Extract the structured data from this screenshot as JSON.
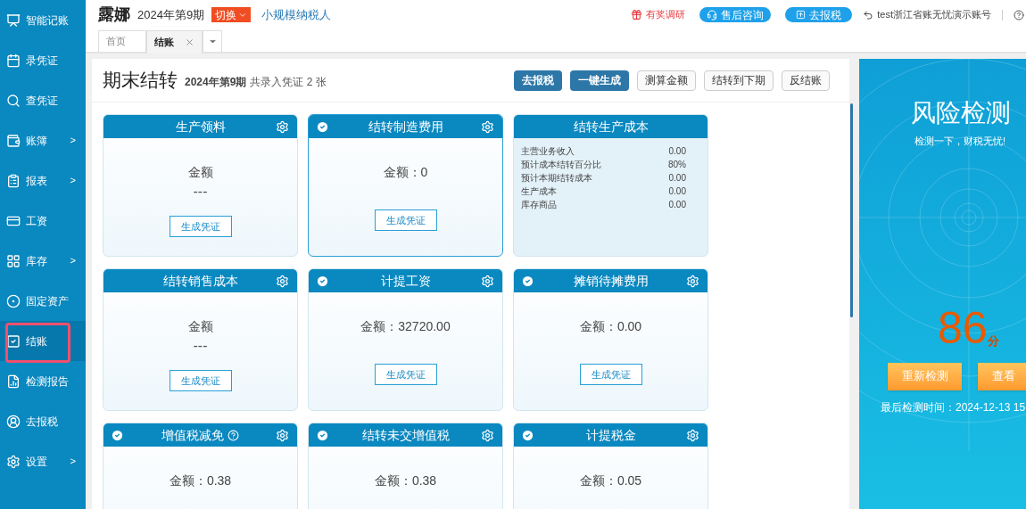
{
  "sidebar": {
    "items": [
      {
        "label": "智能记账",
        "selected": false
      },
      {
        "label": "录凭证",
        "selected": false
      },
      {
        "label": "查凭证",
        "selected": false
      },
      {
        "label": "账簿",
        "arrow": ">",
        "selected": false
      },
      {
        "label": "报表",
        "arrow": ">",
        "selected": false
      },
      {
        "label": "工资",
        "selected": false
      },
      {
        "label": "库存",
        "arrow": ">",
        "selected": false
      },
      {
        "label": "固定资产",
        "selected": false
      },
      {
        "label": "结账",
        "selected": true,
        "outlined": true
      },
      {
        "label": "检测报告",
        "selected": false
      },
      {
        "label": "去报税",
        "selected": false
      },
      {
        "label": "设置",
        "arrow": ">",
        "selected": false
      }
    ]
  },
  "header": {
    "company": "露娜",
    "period": "2024年第9期",
    "switch": "切换",
    "taxpayer": "小规模纳税人",
    "survey": "有奖调研",
    "consult": "售后咨询",
    "file_tax": "去报税",
    "account": "test浙江省账无忧演示账号"
  },
  "tabs": [
    {
      "label": "首页",
      "selected": false,
      "closable": false
    },
    {
      "label": "结账",
      "selected": true,
      "closable": true
    }
  ],
  "main": {
    "title": "期末结转",
    "period": "2024年第9期",
    "summary": "共录入凭证 2 张",
    "buttons": [
      {
        "label": "去报税",
        "kind": "primary"
      },
      {
        "label": "一键生成",
        "kind": "primary"
      },
      {
        "label": "测算金额",
        "kind": "default"
      },
      {
        "label": "结转到下期",
        "kind": "default"
      },
      {
        "label": "反结账",
        "kind": "default"
      }
    ],
    "cards": [
      {
        "title": "生产领料",
        "kind": "pending",
        "checked": false,
        "selected": false,
        "settings": true,
        "label": "金额",
        "value": "---",
        "button": "生成凭证"
      },
      {
        "title": "结转制造费用",
        "kind": "amount",
        "checked": true,
        "selected": true,
        "settings": true,
        "value": "金额：0",
        "button": "生成凭证"
      },
      {
        "title": "结转生产成本",
        "kind": "detail",
        "checked": false,
        "selected": false,
        "settings": false,
        "rows": [
          [
            "主营业务收入",
            "0.00"
          ],
          [
            "预计成本结转百分比",
            "80%"
          ],
          [
            "预计本期结转成本",
            "0.00"
          ],
          [
            "生产成本",
            "0.00"
          ],
          [
            "库存商品",
            "0.00"
          ]
        ]
      },
      {
        "title": "结转销售成本",
        "kind": "pending",
        "checked": false,
        "selected": false,
        "settings": true,
        "label": "金额",
        "value": "---",
        "button": "生成凭证"
      },
      {
        "title": "计提工资",
        "kind": "amount",
        "checked": true,
        "selected": false,
        "settings": true,
        "value": "金额：32720.00",
        "button": "生成凭证"
      },
      {
        "title": "摊销待摊费用",
        "kind": "amount",
        "checked": true,
        "selected": false,
        "settings": true,
        "value": "金额：0.00",
        "button": "生成凭证"
      },
      {
        "title": "增值税减免",
        "kind": "amount",
        "checked": true,
        "selected": false,
        "settings": true,
        "help": true,
        "value": "金额：0.38"
      },
      {
        "title": "结转未交增值税",
        "kind": "amount",
        "checked": true,
        "selected": false,
        "settings": true,
        "value": "金额：0.38"
      },
      {
        "title": "计提税金",
        "kind": "amount",
        "checked": true,
        "selected": false,
        "settings": true,
        "value": "金额：0.05"
      }
    ]
  },
  "risk": {
    "title": "风险检测",
    "subtitle": "检测一下，财税无忧!",
    "score": "86",
    "unit": "分",
    "buttons": [
      "重新检测",
      "查看"
    ],
    "last_check": "最后检测时间：2024-12-13 15"
  }
}
